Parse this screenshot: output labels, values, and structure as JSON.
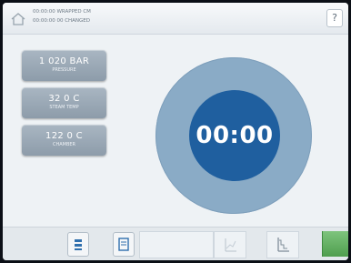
{
  "header": {
    "status_line_1": "00:00:00 WRAPPED CM",
    "status_line_2": "00:00:00 00 CHANGED",
    "help_label": "?"
  },
  "params": [
    {
      "value": "1 020 BAR",
      "label": "PRESSURE"
    },
    {
      "value": "32 0 C",
      "label": "STEAM TEMP"
    },
    {
      "value": "122 0 C",
      "label": "CHAMBER"
    }
  ],
  "timer": {
    "display": "00:00"
  },
  "colors": {
    "dial_outer": "#8aabc6",
    "dial_inner": "#1f5f9f",
    "param_button": "#95a4b2",
    "start_button": "#5fae5e"
  },
  "icons": {
    "home": "home-icon",
    "list": "list-icon",
    "document": "document-icon",
    "chart": "chart-icon",
    "graph": "graph-icon"
  }
}
